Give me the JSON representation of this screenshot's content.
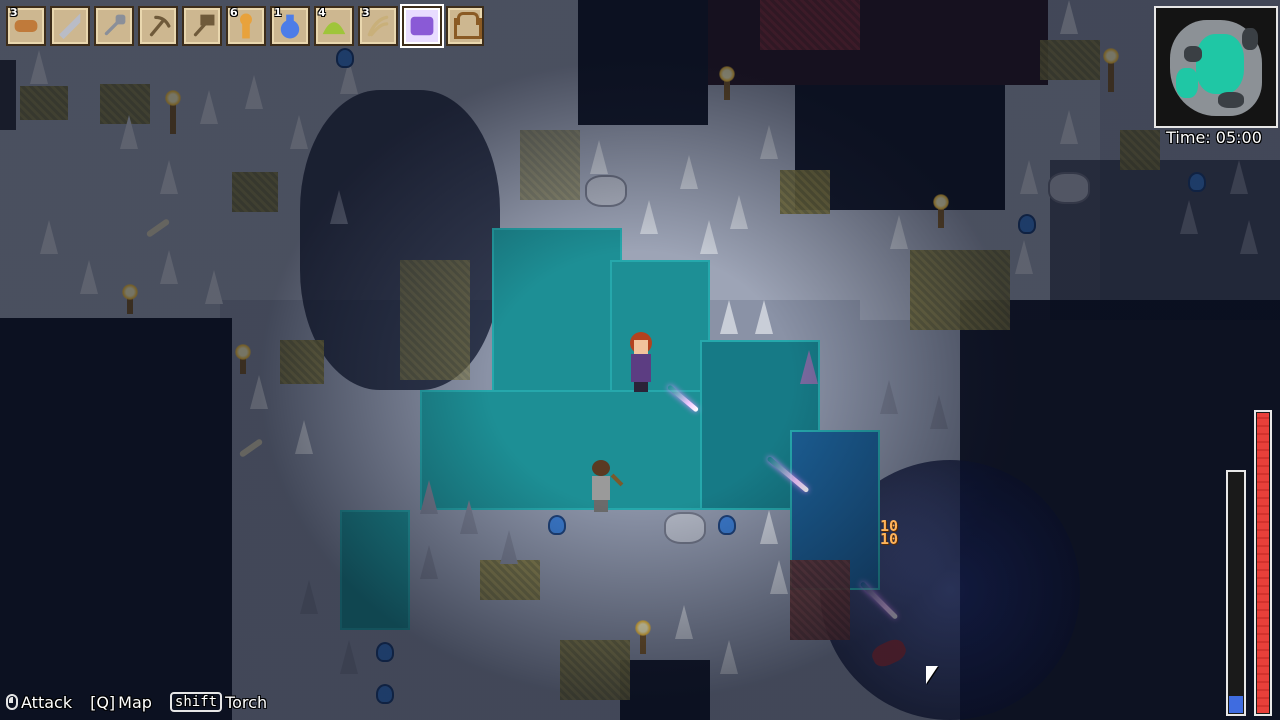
{
  "hotbar": {
    "slots": [
      {
        "item": "wood-log",
        "count": "3",
        "color": "#c07a3a"
      },
      {
        "item": "sword",
        "count": "",
        "color": "#b9bcc6"
      },
      {
        "item": "shovel",
        "count": "",
        "color": "#8a8f99"
      },
      {
        "item": "pickaxe",
        "count": "",
        "color": "#6f5a3a"
      },
      {
        "item": "hammer",
        "count": "",
        "color": "#6f5a3a"
      },
      {
        "item": "torch",
        "count": "6",
        "color": "#e8a23c"
      },
      {
        "item": "potion",
        "count": "1",
        "color": "#4d7de8"
      },
      {
        "item": "heart-berry",
        "count": "4",
        "color": "#9fc53a"
      },
      {
        "item": "fiber",
        "count": "3",
        "color": "#c9b07a"
      },
      {
        "item": "spell-book",
        "count": "",
        "color": "#8a5ad6",
        "selected": true
      }
    ],
    "bag_label": "bag-icon"
  },
  "minimap": {
    "colors": {
      "land": "#8c9196",
      "water": "#1fc7a5",
      "dark": "#3a3f44"
    }
  },
  "clock": {
    "label": "Time:",
    "value": "05:00"
  },
  "player": {
    "health_pct": 100,
    "hunger_pct": 8
  },
  "damage_number": "10",
  "controls": [
    {
      "key": "mouse-left",
      "label": "Attack"
    },
    {
      "key": "[Q]",
      "label": "Map"
    },
    {
      "key": "shift",
      "label": "Torch"
    }
  ]
}
